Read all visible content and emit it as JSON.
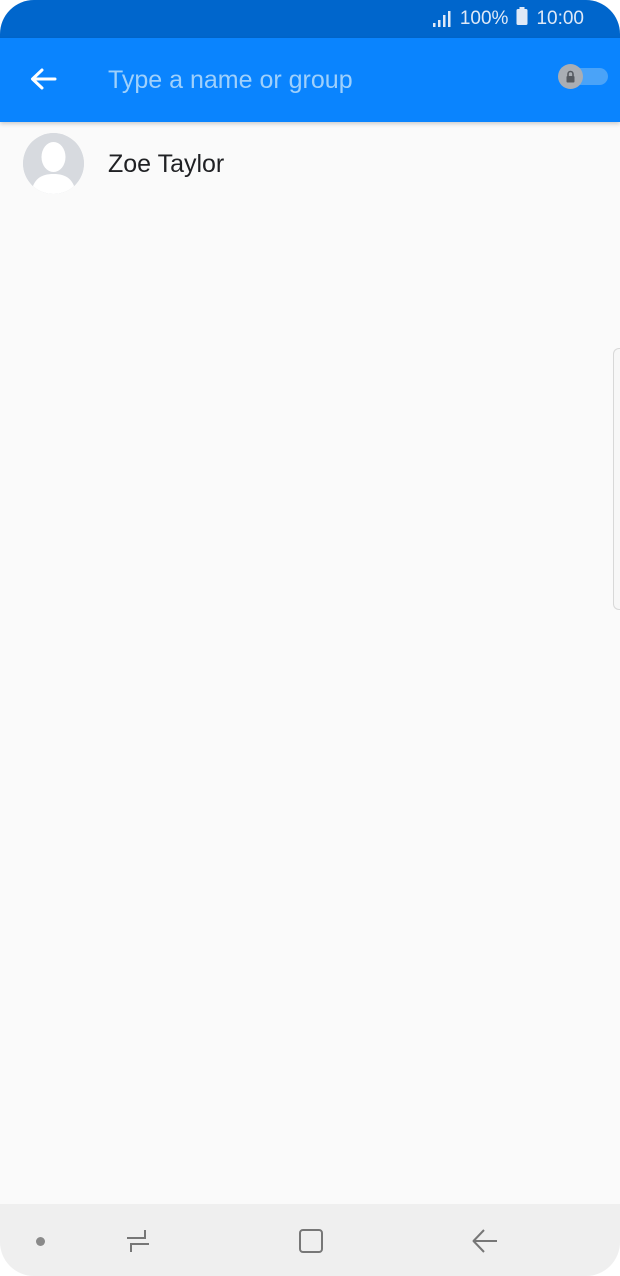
{
  "status_bar": {
    "battery_percent": "100%",
    "time": "10:00",
    "icons": [
      "signal-icon",
      "battery-icon"
    ]
  },
  "app_bar": {
    "back_icon": "arrow-left-icon",
    "search_placeholder": "Type a name or group",
    "search_value": "",
    "secret_toggle": {
      "state": "off",
      "icon": "lock-icon"
    }
  },
  "contacts": [
    {
      "name": "Zoe Taylor",
      "avatar_icon": "person-silhouette-icon"
    }
  ],
  "nav_bar": {
    "buttons": [
      "recents-icon",
      "home-icon",
      "back-icon"
    ]
  },
  "colors": {
    "status_bar": "#0066cc",
    "app_bar": "#0a84fe",
    "placeholder": "#9fd0fb",
    "background": "#fafafa",
    "nav_bar": "#efefef"
  }
}
